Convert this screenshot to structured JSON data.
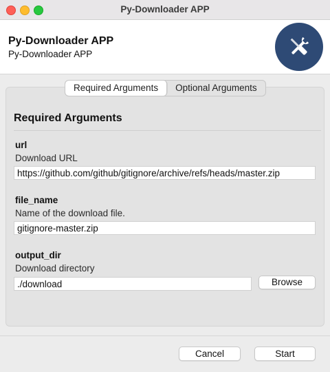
{
  "window": {
    "title": "Py-Downloader APP"
  },
  "header": {
    "title": "Py-Downloader APP",
    "subtitle": "Py-Downloader APP",
    "logo_icon": "tools-icon",
    "logo_color": "#2e4a75"
  },
  "tabs": [
    {
      "label": "Required Arguments",
      "active": true
    },
    {
      "label": "Optional Arguments",
      "active": false
    }
  ],
  "section": {
    "title": "Required Arguments"
  },
  "fields": {
    "url": {
      "name": "url",
      "description": "Download URL",
      "value": "https://github.com/github/gitignore/archive/refs/heads/master.zip"
    },
    "file_name": {
      "name": "file_name",
      "description": "Name of the download file.",
      "value": "gitignore-master.zip"
    },
    "output_dir": {
      "name": "output_dir",
      "description": "Download directory",
      "value": "./download",
      "browse_label": "Browse"
    }
  },
  "footer": {
    "cancel_label": "Cancel",
    "start_label": "Start"
  },
  "colors": {
    "close": "#fe5f57",
    "minimize": "#febc2e",
    "maximize": "#28c840"
  }
}
